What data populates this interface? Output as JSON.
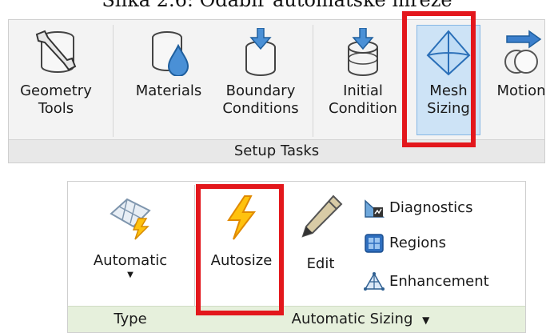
{
  "caption": "Slika 2.6: Odabir automatske mreže",
  "setup_ribbon": {
    "group_label": "Setup Tasks",
    "buttons": [
      {
        "line1": "Geometry",
        "line2": "Tools",
        "icon": "wrench-cylinder-icon"
      },
      {
        "line1": "Materials",
        "line2": "",
        "icon": "water-drop-cylinder-icon"
      },
      {
        "line1": "Boundary",
        "line2": "Conditions",
        "icon": "arrow-into-cylinder-icon"
      },
      {
        "line1": "Initial",
        "line2": "Condition",
        "icon": "arrow-into-cylinder-outline-icon"
      },
      {
        "line1": "Mesh",
        "line2": "Sizing",
        "icon": "mesh-diamond-icon"
      },
      {
        "line1": "Motion",
        "line2": "",
        "icon": "motion-arrow-icon"
      }
    ],
    "highlight_color": "#e3171c",
    "selected_bg": "#cde3f6"
  },
  "mesh_ribbon": {
    "type_group_label": "Type",
    "sizing_group_label": "Automatic Sizing",
    "automatic_label": "Automatic",
    "autosize_label": "Autosize",
    "edit_label": "Edit",
    "small_items": [
      {
        "label": "Diagnostics",
        "icon": "diagnostics-icon"
      },
      {
        "label": "Regions",
        "icon": "regions-icon"
      },
      {
        "label": "Enhancement",
        "icon": "enhancement-icon"
      }
    ],
    "footer_color": "#e6f0dc"
  }
}
